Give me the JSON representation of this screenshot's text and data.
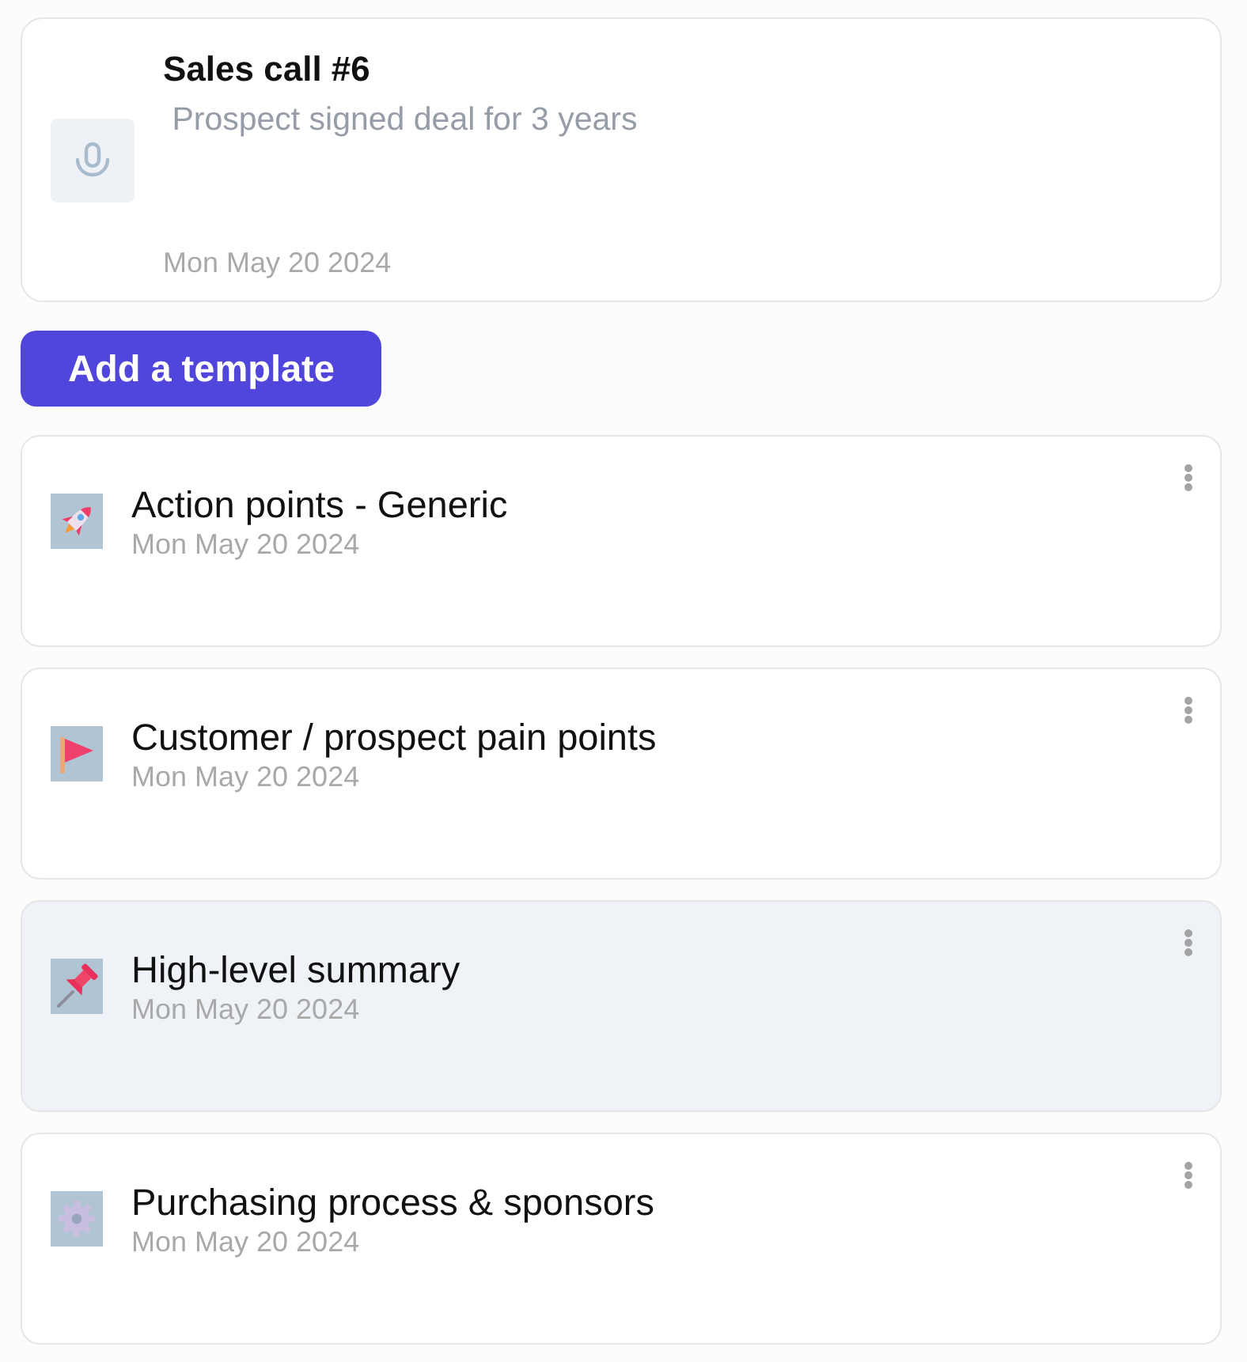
{
  "call": {
    "title": "Sales call #6",
    "summary": " Prospect signed deal for 3 years",
    "date": "Mon May 20 2024"
  },
  "add_button": {
    "label": "Add a template"
  },
  "templates": [
    {
      "kind": "rocket",
      "title": "Action points - Generic",
      "date": "Mon May 20 2024",
      "selected": false
    },
    {
      "kind": "flag",
      "title": "Customer / prospect pain points",
      "date": "Mon May 20 2024",
      "selected": false
    },
    {
      "kind": "pin",
      "title": "High-level summary",
      "date": "Mon May 20 2024",
      "selected": true
    },
    {
      "kind": "gear",
      "title": "Purchasing process & sponsors",
      "date": "Mon May 20 2024",
      "selected": false
    }
  ]
}
